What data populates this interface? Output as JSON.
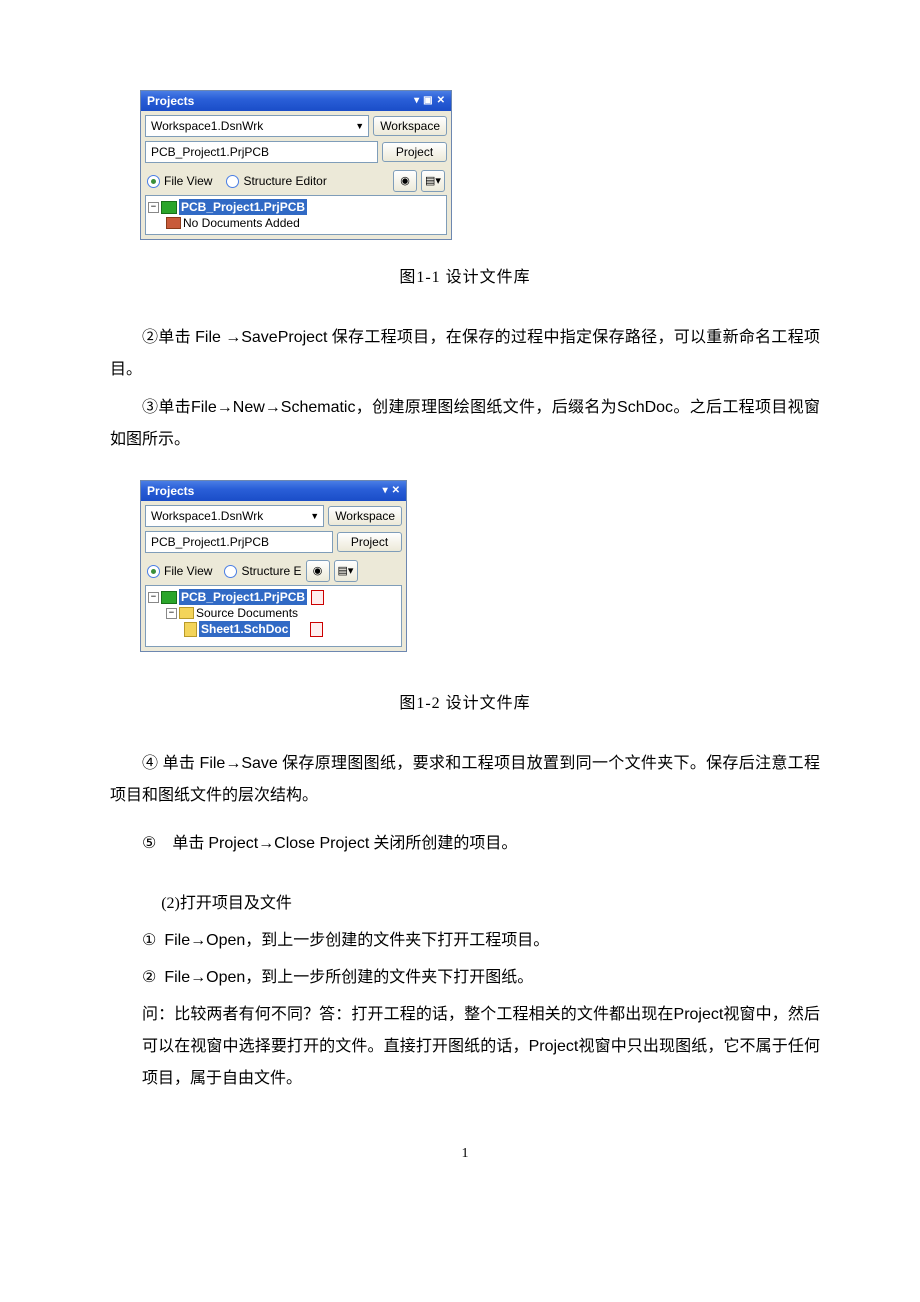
{
  "panel1": {
    "title": "Projects",
    "workspace": "Workspace1.DsnWrk",
    "workspace_btn": "Workspace",
    "project": "PCB_Project1.PrjPCB",
    "project_btn": "Project",
    "fileview": "File View",
    "structure": "Structure Editor",
    "tree_project": "PCB_Project1.PrjPCB",
    "tree_nodocs": "No Documents Added"
  },
  "caption1": "图1-1  设计文件库",
  "para2": "②单击 File →SaveProject  保存工程项目，在保存的过程中指定保存路径，可以重新命名工程项目。",
  "para3": "③单击File→New→Schematic，创建原理图绘图纸文件，后缀名为SchDoc。之后工程项目视窗如图所示。",
  "panel2": {
    "title": "Projects",
    "workspace": "Workspace1.DsnWrk",
    "workspace_btn": "Workspace",
    "project": "PCB_Project1.PrjPCB",
    "project_btn": "Project",
    "fileview": "File View",
    "structure": "Structure E",
    "tree_project": "PCB_Project1.PrjPCB",
    "tree_source": "Source Documents",
    "tree_sheet": "Sheet1.SchDoc"
  },
  "caption2": "图1-2  设计文件库",
  "para4": "④ 单击 File→Save 保存原理图图纸，要求和工程项目放置到同一个文件夹下。保存后注意工程项目和图纸文件的层次结构。",
  "para5_prefix": "⑤",
  "para5": "单击 Project→Close Project 关闭所创建的项目。",
  "section2_title": "(2)打开项目及文件",
  "item1": "①  File→Open，到上一步创建的文件夹下打开工程项目。",
  "item2": "②  File→Open，到上一步所创建的文件夹下打开图纸。",
  "qa": "问：比较两者有何不同？答：打开工程的话，整个工程相关的文件都出现在Project视窗中，然后可以在视窗中选择要打开的文件。直接打开图纸的话，Project视窗中只出现图纸，它不属于任何项目，属于自由文件。",
  "pagenum": "1"
}
